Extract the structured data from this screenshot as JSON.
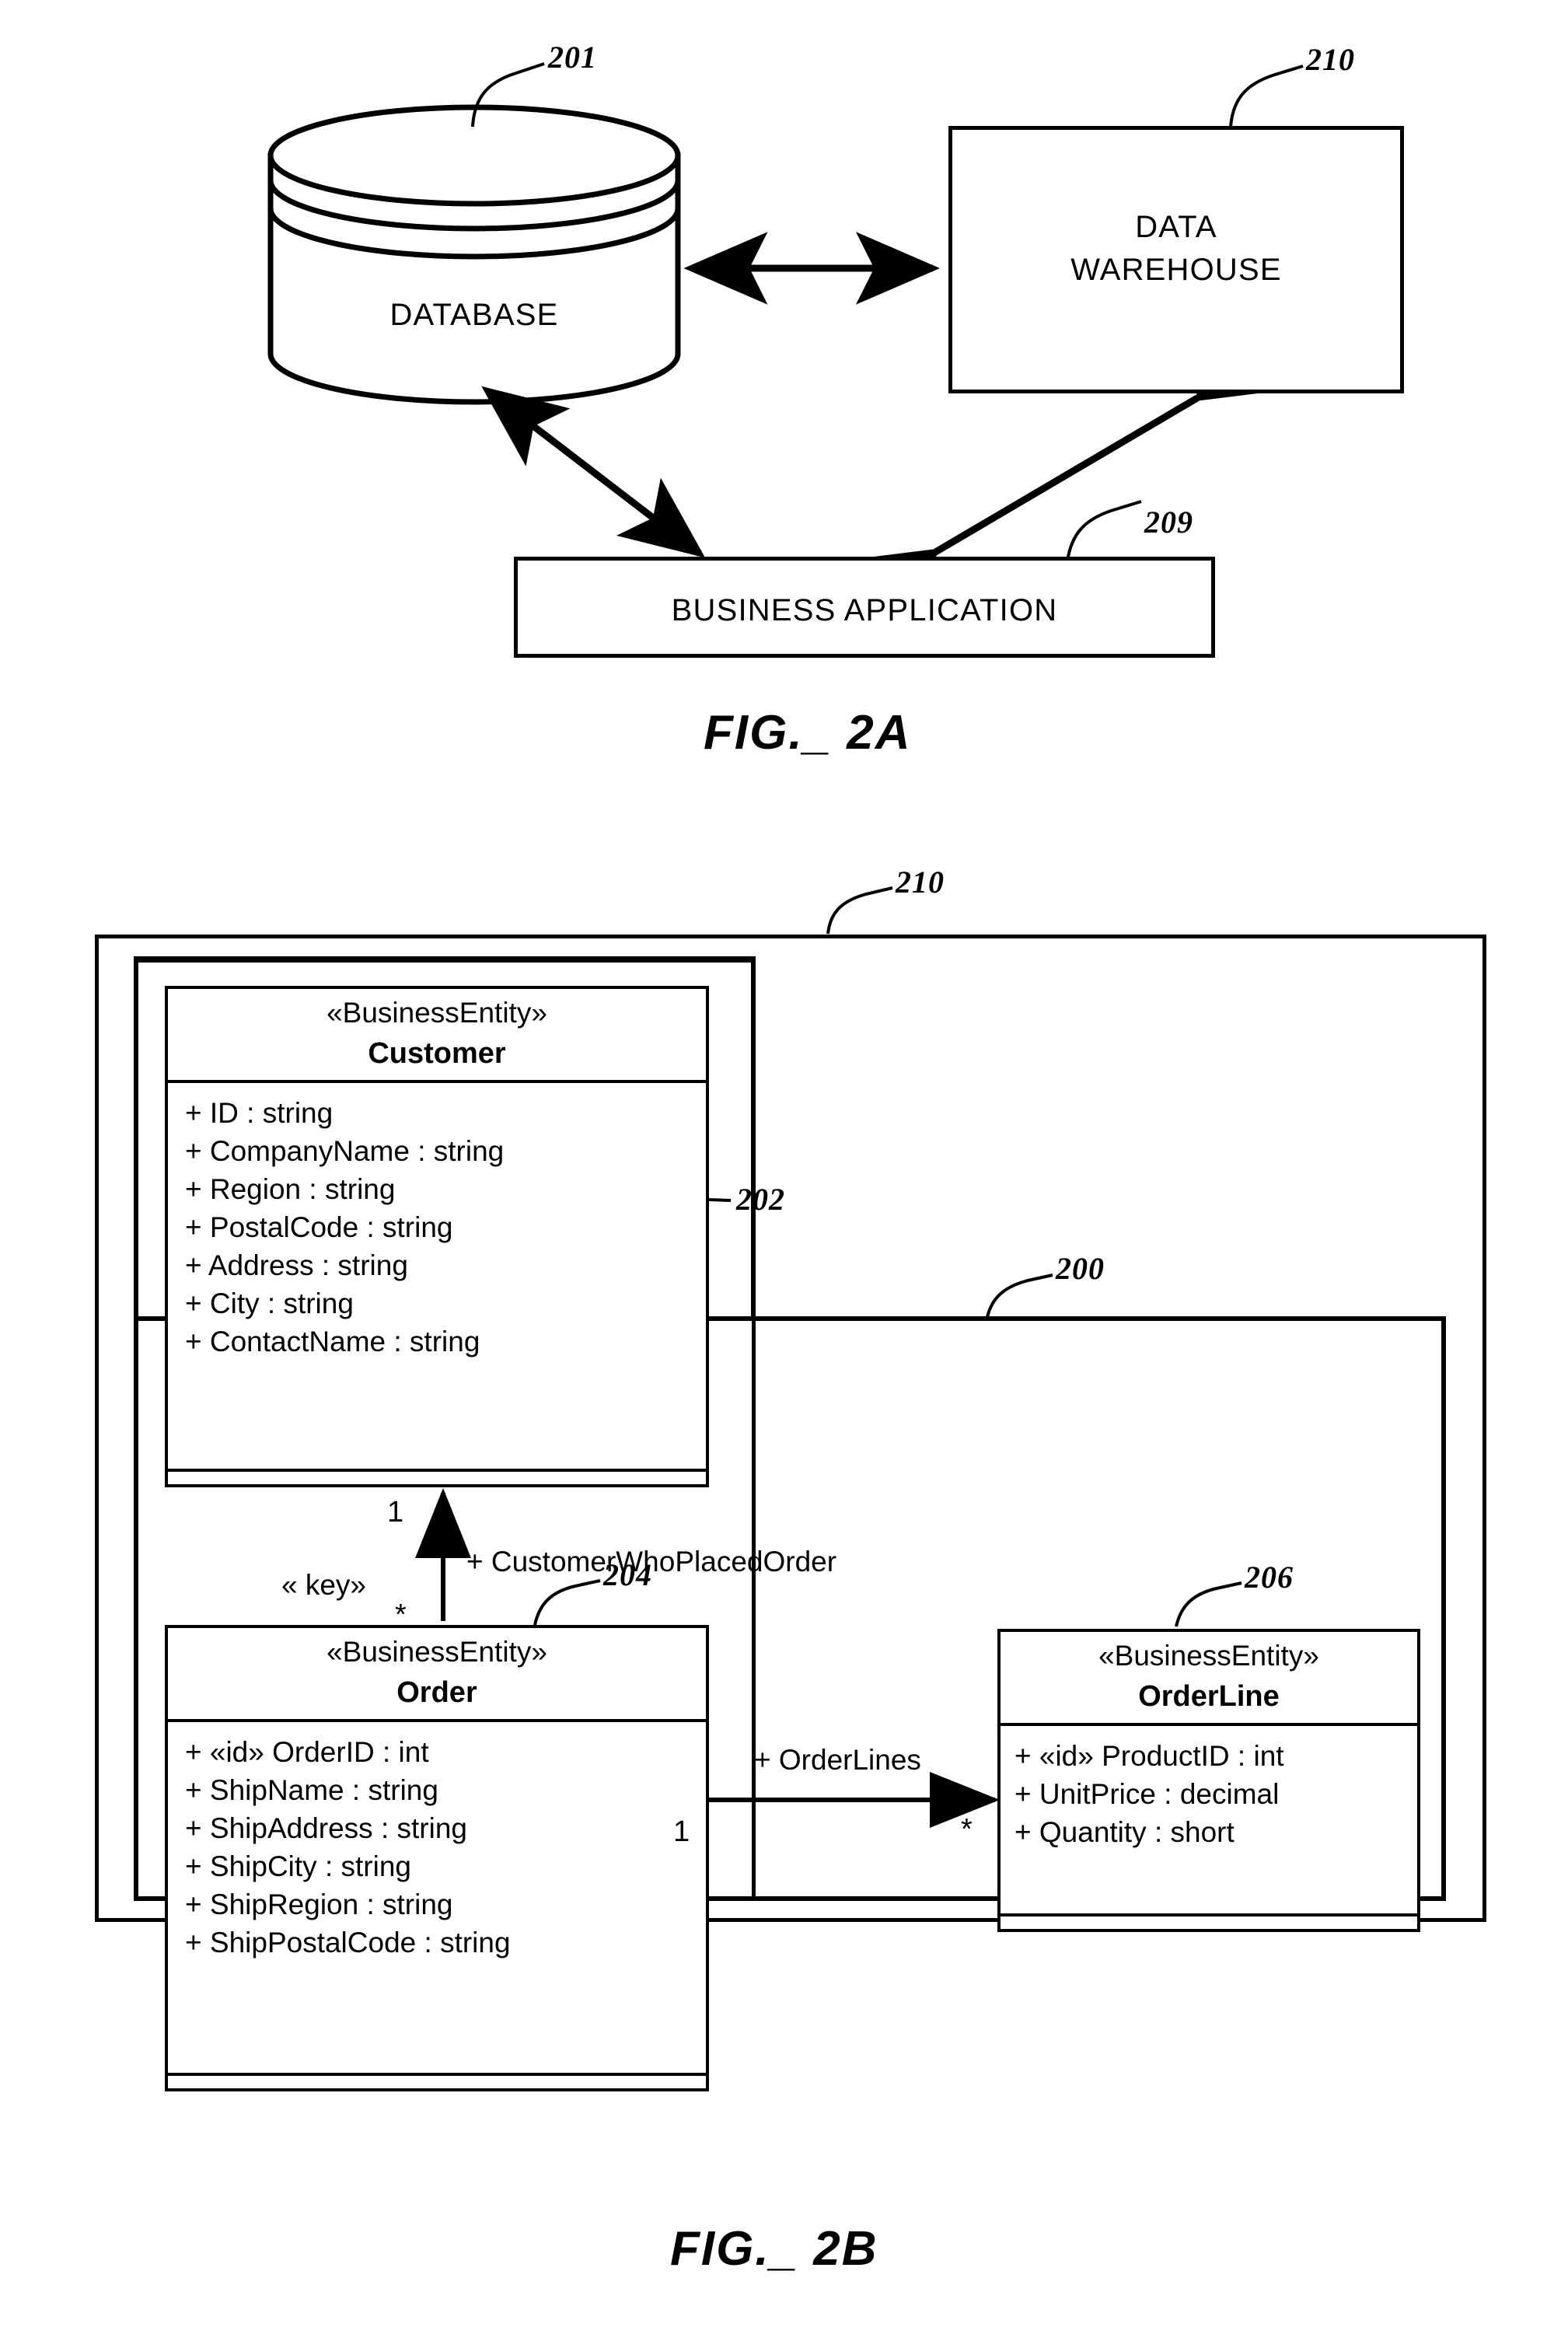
{
  "figures": [
    {
      "caption": "FIG._ 2A",
      "nodes": {
        "database": {
          "label": "DATABASE",
          "ref": "201"
        },
        "data_warehouse": {
          "label_line1": "DATA",
          "label_line2": "WAREHOUSE",
          "ref": "210"
        },
        "business_application": {
          "label": "BUSINESS APPLICATION",
          "ref": "209"
        }
      },
      "connections": [
        {
          "from": "database",
          "to": "data_warehouse",
          "arrow": "double"
        },
        {
          "from": "database",
          "to": "business_application",
          "arrow": "double"
        },
        {
          "from": "data_warehouse",
          "to": "business_application",
          "arrow": "double"
        }
      ]
    },
    {
      "caption": "FIG._ 2B",
      "refs": {
        "outer": "210",
        "inner": "200",
        "customer": "202",
        "order": "204",
        "orderline": "206"
      },
      "classes": [
        {
          "stereotype": "«BusinessEntity»",
          "name": "Customer",
          "attributes": [
            "+ ID : string",
            "+ CompanyName : string",
            "+ Region : string",
            "+ PostalCode : string",
            "+ Address : string",
            "+ City : string",
            "+ ContactName : string"
          ]
        },
        {
          "stereotype": "«BusinessEntity»",
          "name": "Order",
          "attributes": [
            "+ «id» OrderID : int",
            "+ ShipName : string",
            "+ ShipAddress : string",
            "+ ShipCity : string",
            "+ ShipRegion : string",
            "+ ShipPostalCode : string"
          ]
        },
        {
          "stereotype": "«BusinessEntity»",
          "name": "OrderLine",
          "attributes": [
            "+ «id» ProductID : int",
            "+ UnitPrice : decimal",
            "+ Quantity : short"
          ]
        }
      ],
      "associations": [
        {
          "name": "+ CustomerWhoPlacedOrder",
          "stereotype": "« key»",
          "source_multiplicity": "*",
          "target_multiplicity": "1",
          "from": "Order",
          "to": "Customer",
          "kind": "navigable-association"
        },
        {
          "name": "+ OrderLines",
          "source_multiplicity": "1",
          "target_multiplicity": "*",
          "from": "Order",
          "to": "OrderLine",
          "kind": "composition"
        }
      ]
    }
  ]
}
